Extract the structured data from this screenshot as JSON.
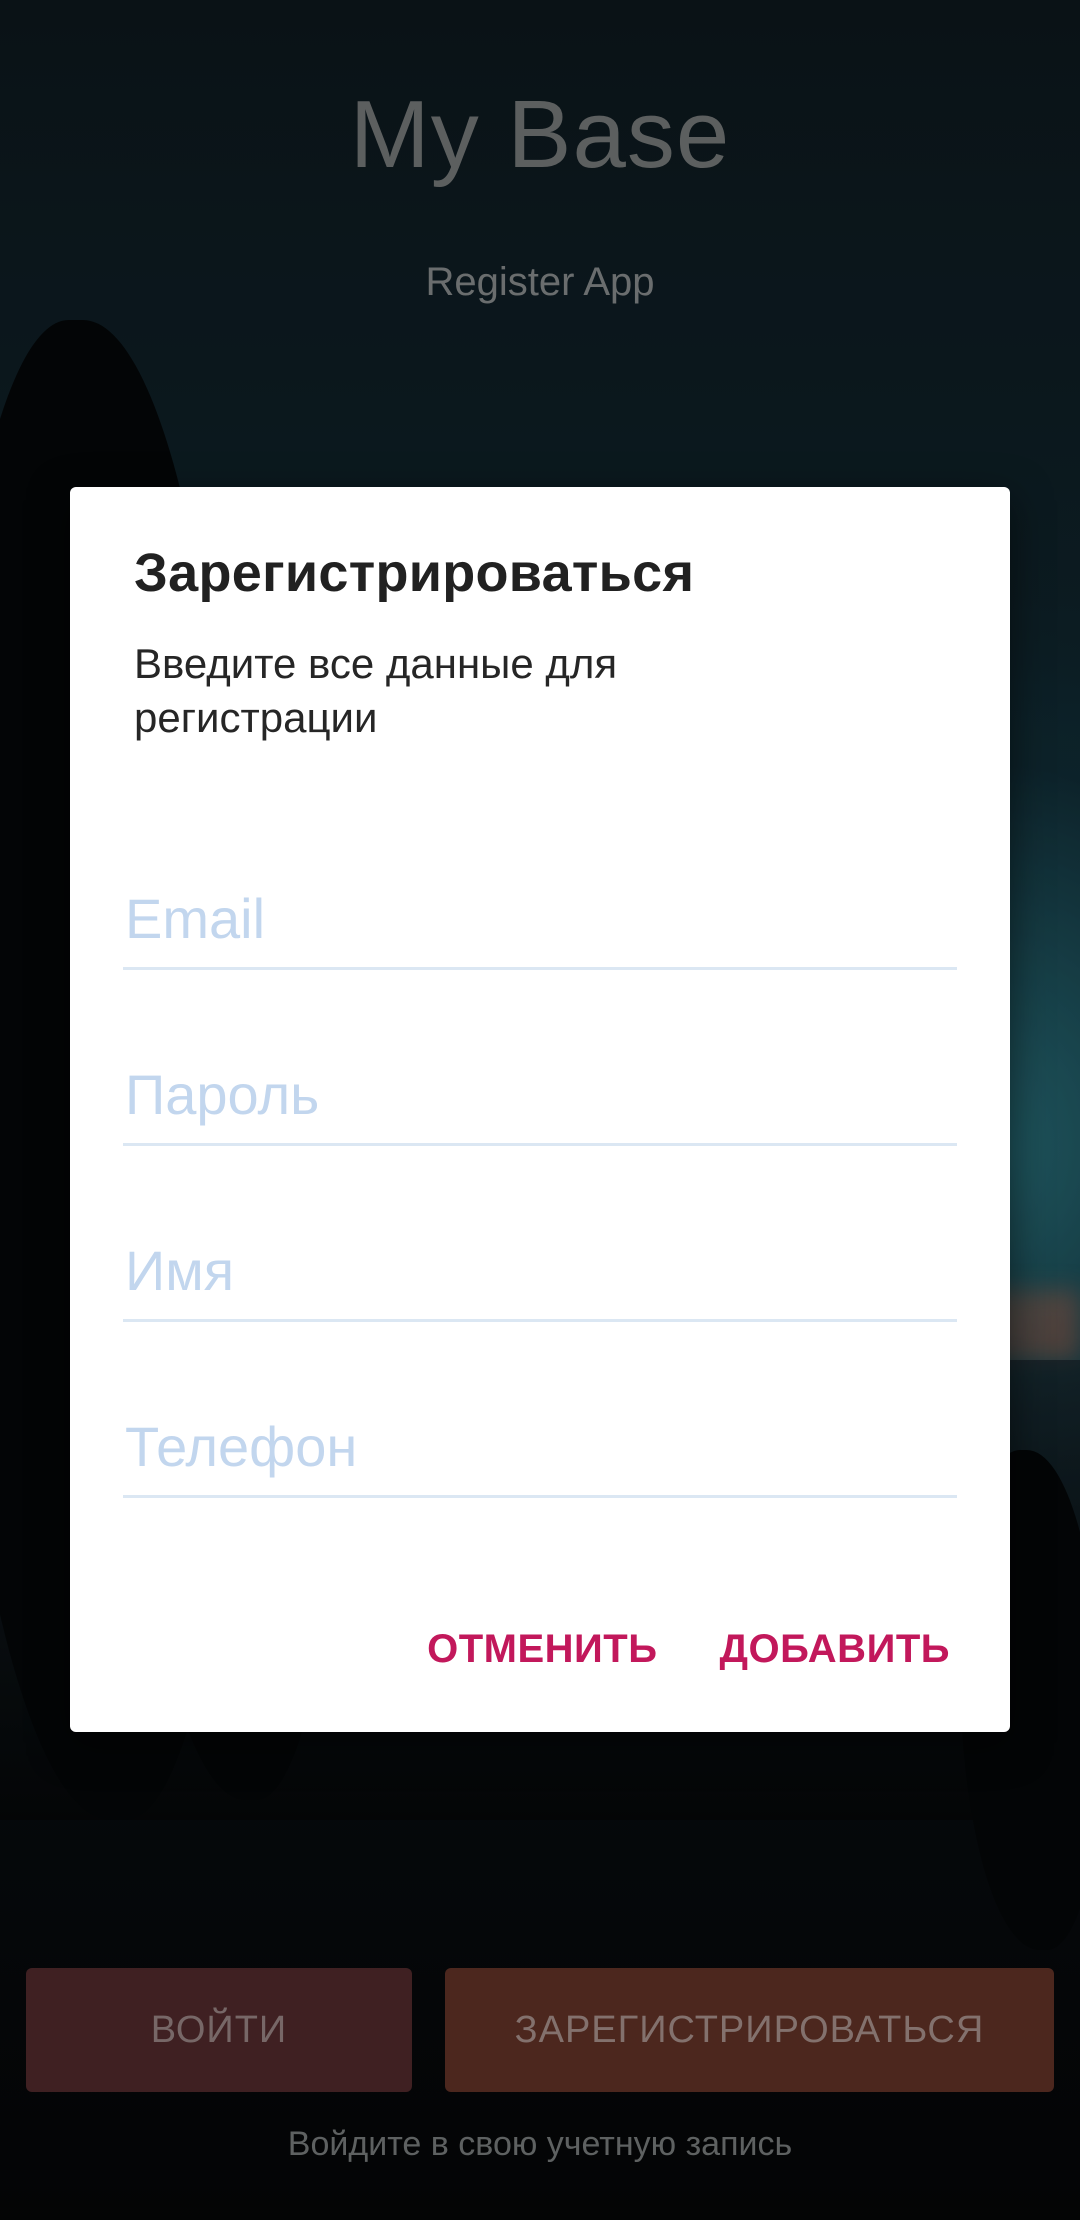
{
  "app": {
    "title": "My Base",
    "subtitle": "Register App"
  },
  "bottom": {
    "login_label": "ВОЙТИ",
    "register_label": "ЗАРЕГИСТРИРОВАТЬСЯ",
    "hint": "Войдите в свою учетную запись"
  },
  "dialog": {
    "title": "Зарегистрироваться",
    "message": "Введите все данные для регистрации",
    "fields": [
      {
        "placeholder": "Email",
        "value": ""
      },
      {
        "placeholder": "Пароль",
        "value": ""
      },
      {
        "placeholder": "Имя",
        "value": ""
      },
      {
        "placeholder": "Телефон",
        "value": ""
      }
    ],
    "cancel_label": "ОТМЕНИТЬ",
    "add_label": "ДОБАВИТЬ"
  },
  "colors": {
    "accent": "#c2185b",
    "field_placeholder": "#c2d6ee",
    "field_underline": "#dbe7f3",
    "login_button_bg": "#4a2628",
    "register_button_bg": "#5a2e24"
  }
}
